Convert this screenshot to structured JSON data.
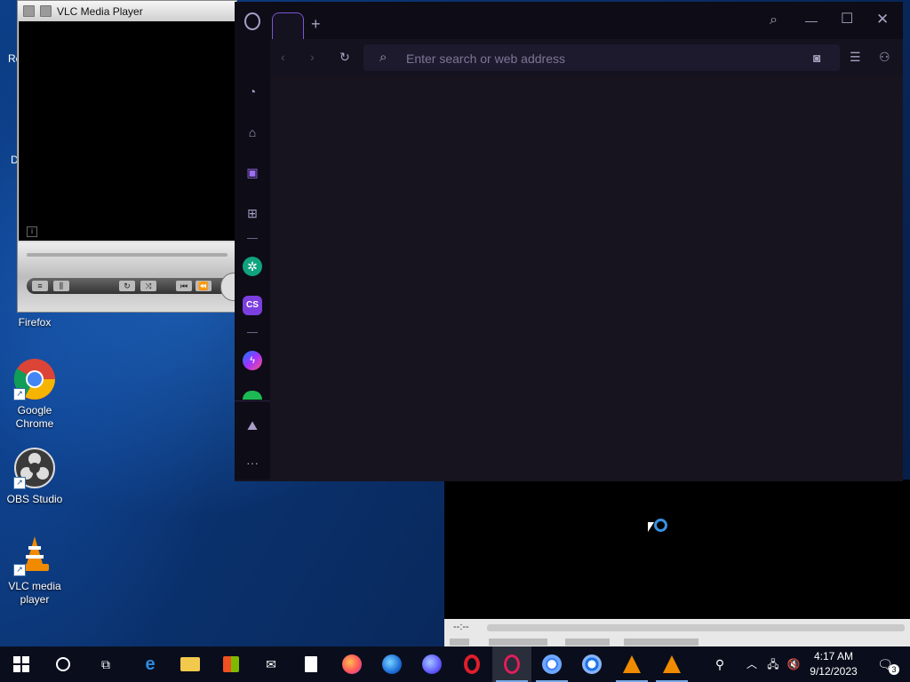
{
  "desktop": {
    "icons": [
      {
        "label": "Firefox",
        "color": "#e86a1c"
      },
      {
        "label": "Google Chrome",
        "color": "#4285f4"
      },
      {
        "label": "OBS Studio",
        "color": "#2f2f2f"
      },
      {
        "label": "VLC media player",
        "color": "#f08a00"
      }
    ],
    "partial_labels": {
      "left_1": "Re",
      "left_2": "D"
    }
  },
  "vlc_mini": {
    "title": "VLC Media Player"
  },
  "opera": {
    "new_tab_symbol": "+",
    "address_placeholder": "Enter search or web address",
    "accent": "#7b55d6",
    "sidebar_items": [
      {
        "name": "speed-dial-icon"
      },
      {
        "name": "shopping-icon"
      },
      {
        "name": "twitch-icon"
      },
      {
        "name": "chip-icon"
      },
      {
        "name": "chatgpt-icon"
      },
      {
        "name": "cs-icon",
        "label": "CS"
      },
      {
        "name": "messenger-icon"
      },
      {
        "name": "spotify-icon"
      },
      {
        "name": "gallery-icon"
      },
      {
        "name": "more-icon",
        "label": "···"
      }
    ]
  },
  "vlc_main": {
    "time": "--:--"
  },
  "taskbar": {
    "time": "4:17 AM",
    "date": "9/12/2023",
    "notification_count": "3"
  }
}
